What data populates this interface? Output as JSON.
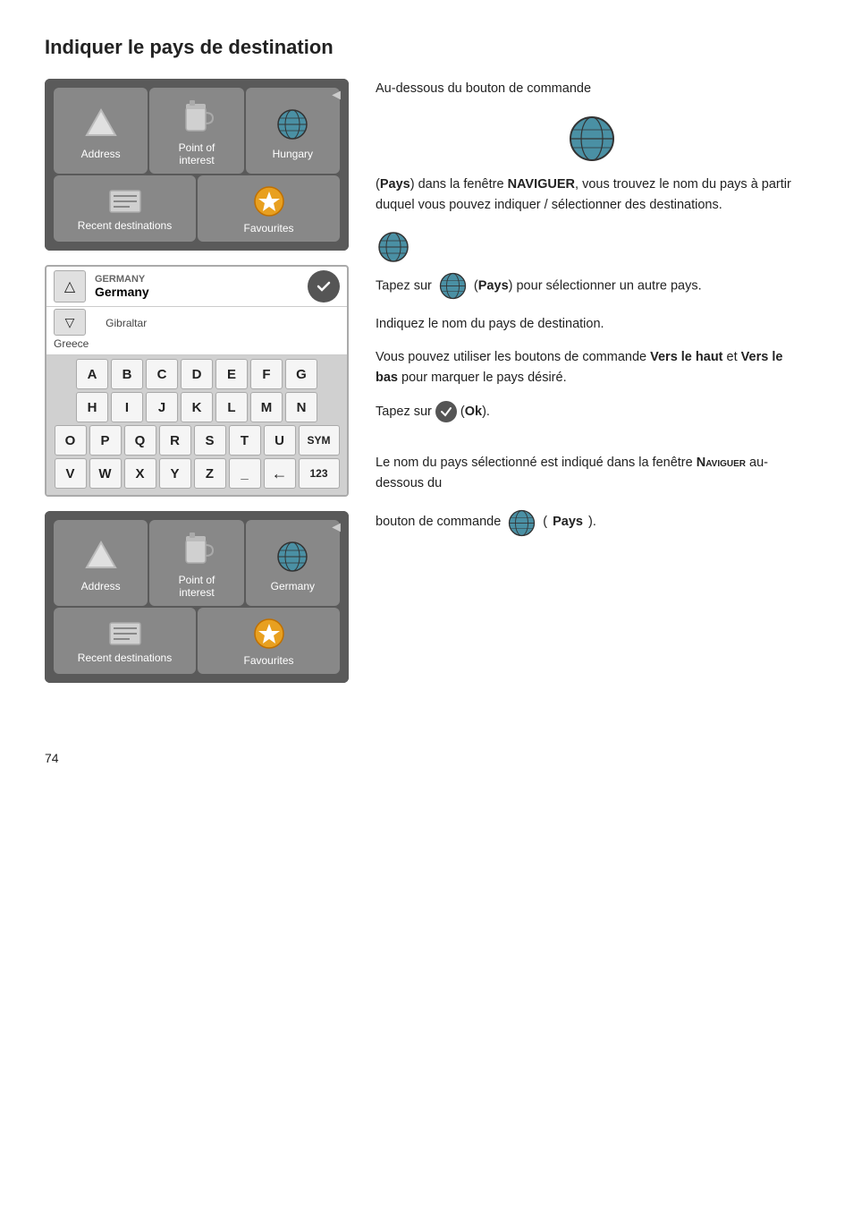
{
  "page": {
    "title": "Indiquer le pays de destination",
    "page_number": "74"
  },
  "nav_screen_1": {
    "btn1_label": "Address",
    "btn2_label": "Point of\ninterest",
    "btn3_label": "Hungary",
    "btn4_label": "Recent destinations",
    "btn5_label": "Favourites",
    "arrow": "◄"
  },
  "keyboard_screen": {
    "country_code": "GERMANY",
    "country_selected": "Germany",
    "ok_check": "✓",
    "alt_countries": "Gibraltar\nGreece",
    "rows": [
      [
        "A",
        "B",
        "C",
        "D",
        "E",
        "F",
        "G"
      ],
      [
        "H",
        "I",
        "J",
        "K",
        "L",
        "M",
        "N"
      ],
      [
        "O",
        "P",
        "Q",
        "R",
        "S",
        "T",
        "U",
        "SYM"
      ],
      [
        "V",
        "W",
        "X",
        "Y",
        "Z",
        "_",
        "←",
        "123"
      ]
    ]
  },
  "nav_screen_2": {
    "btn1_label": "Address",
    "btn2_label": "Point of\ninterest",
    "btn3_label": "Germany",
    "btn4_label": "Recent destinations",
    "btn5_label": "Favourites",
    "arrow": "◄"
  },
  "right_col": {
    "para1": "Au-dessous du bouton de commande",
    "pays_label": "Pays",
    "para1b": " dans la fenêtre ",
    "naviguer_label": "NAVIGUER",
    "para1c": ", vous trouvez le nom du pays à partir duquel vous pouvez indiquer / sélectionner des destinations.",
    "para2_prefix": "Tapez sur",
    "pays_label2": "Pays",
    "para2_suffix": " pour sélectionner un autre pays.",
    "para3": "Indiquez le nom du pays de destination.",
    "para4": "Vous pouvez utiliser les boutons de commande ",
    "vers_haut": "Vers le haut",
    "et": " et ",
    "vers_bas": "Vers le bas",
    "para4_suffix": " pour marquer le pays désiré.",
    "para5_prefix": "Tapez sur",
    "ok_label": "Ok",
    "para5_suffix": " (",
    "para5_end": ").",
    "para6": "Le nom du pays sélectionné est indiqué dans la fenêtre ",
    "naviguer_label2": "NAVIGUER",
    "para6b": " au-dessous du",
    "para7_prefix": "bouton de commande",
    "pays_label3": "Pays",
    "para7_suffix": ")."
  }
}
